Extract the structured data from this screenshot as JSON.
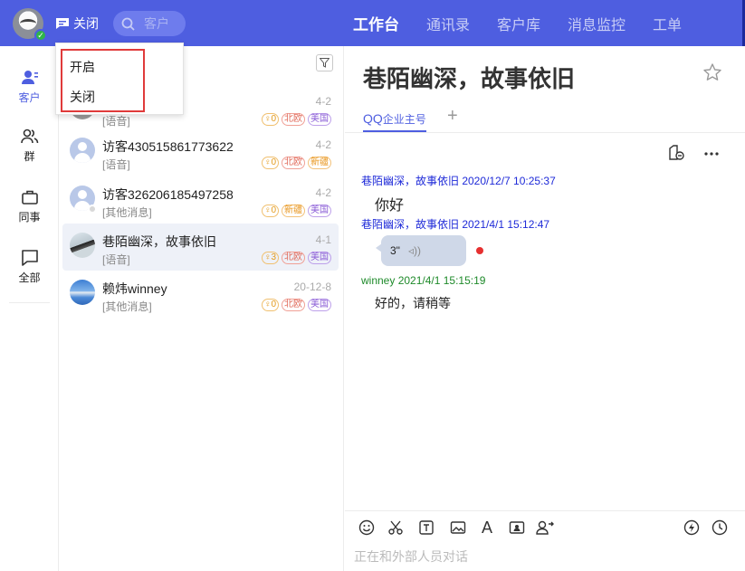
{
  "header": {
    "status_label": "关闭",
    "search_placeholder": "客户",
    "nav": [
      "工作台",
      "通讯录",
      "客户库",
      "消息监控",
      "工单"
    ],
    "active_nav": "工作台"
  },
  "status_menu": {
    "options": [
      "开启",
      "关闭"
    ]
  },
  "sidebar": {
    "items": [
      {
        "label": "客户",
        "icon": "customer-icon",
        "active": true
      },
      {
        "label": "群",
        "icon": "group-icon"
      },
      {
        "label": "同事",
        "icon": "briefcase-icon"
      },
      {
        "label": "全部",
        "icon": "chat-bubble-icon"
      }
    ]
  },
  "conversations": [
    {
      "name": "",
      "sub": "[语音]",
      "time": "4-2",
      "tags": [
        "0",
        "北欧",
        "美国"
      ]
    },
    {
      "name": "访客430515861773622",
      "sub": "[语音]",
      "time": "4-2",
      "tags": [
        "0",
        "北欧",
        "新疆"
      ]
    },
    {
      "name": "访客326206185497258",
      "sub": "[其他消息]",
      "time": "4-2",
      "tags": [
        "0",
        "新疆",
        "美国"
      ]
    },
    {
      "name": "巷陌幽深，故事依旧",
      "sub": "[语音]",
      "time": "4-1",
      "tags": [
        "3",
        "北欧",
        "美国"
      ]
    },
    {
      "name": "赖炜winney",
      "sub": "[其他消息]",
      "time": "20-12-8",
      "tags": [
        "0",
        "北欧",
        "美国"
      ]
    }
  ],
  "chat": {
    "title": "巷陌幽深，故事依旧",
    "tab_main": "QQ",
    "tab_sub": "企业主号",
    "messages": [
      {
        "sender": "巷陌幽深，故事依旧 2020/12/7 10:25:37",
        "text": "你好"
      },
      {
        "sender": "巷陌幽深，故事依旧 2021/4/1 15:12:47",
        "voice_duration": "3\""
      },
      {
        "sender": "winney 2021/4/1 15:15:19",
        "text": "好的，请稍等"
      }
    ],
    "compose_placeholder": "正在和外部人员对话"
  },
  "colors": {
    "brand": "#4e5ee0",
    "highlight_box": "#e03b3b",
    "sender_customer": "#1e2ad8",
    "sender_agent": "#1e8a2a"
  }
}
